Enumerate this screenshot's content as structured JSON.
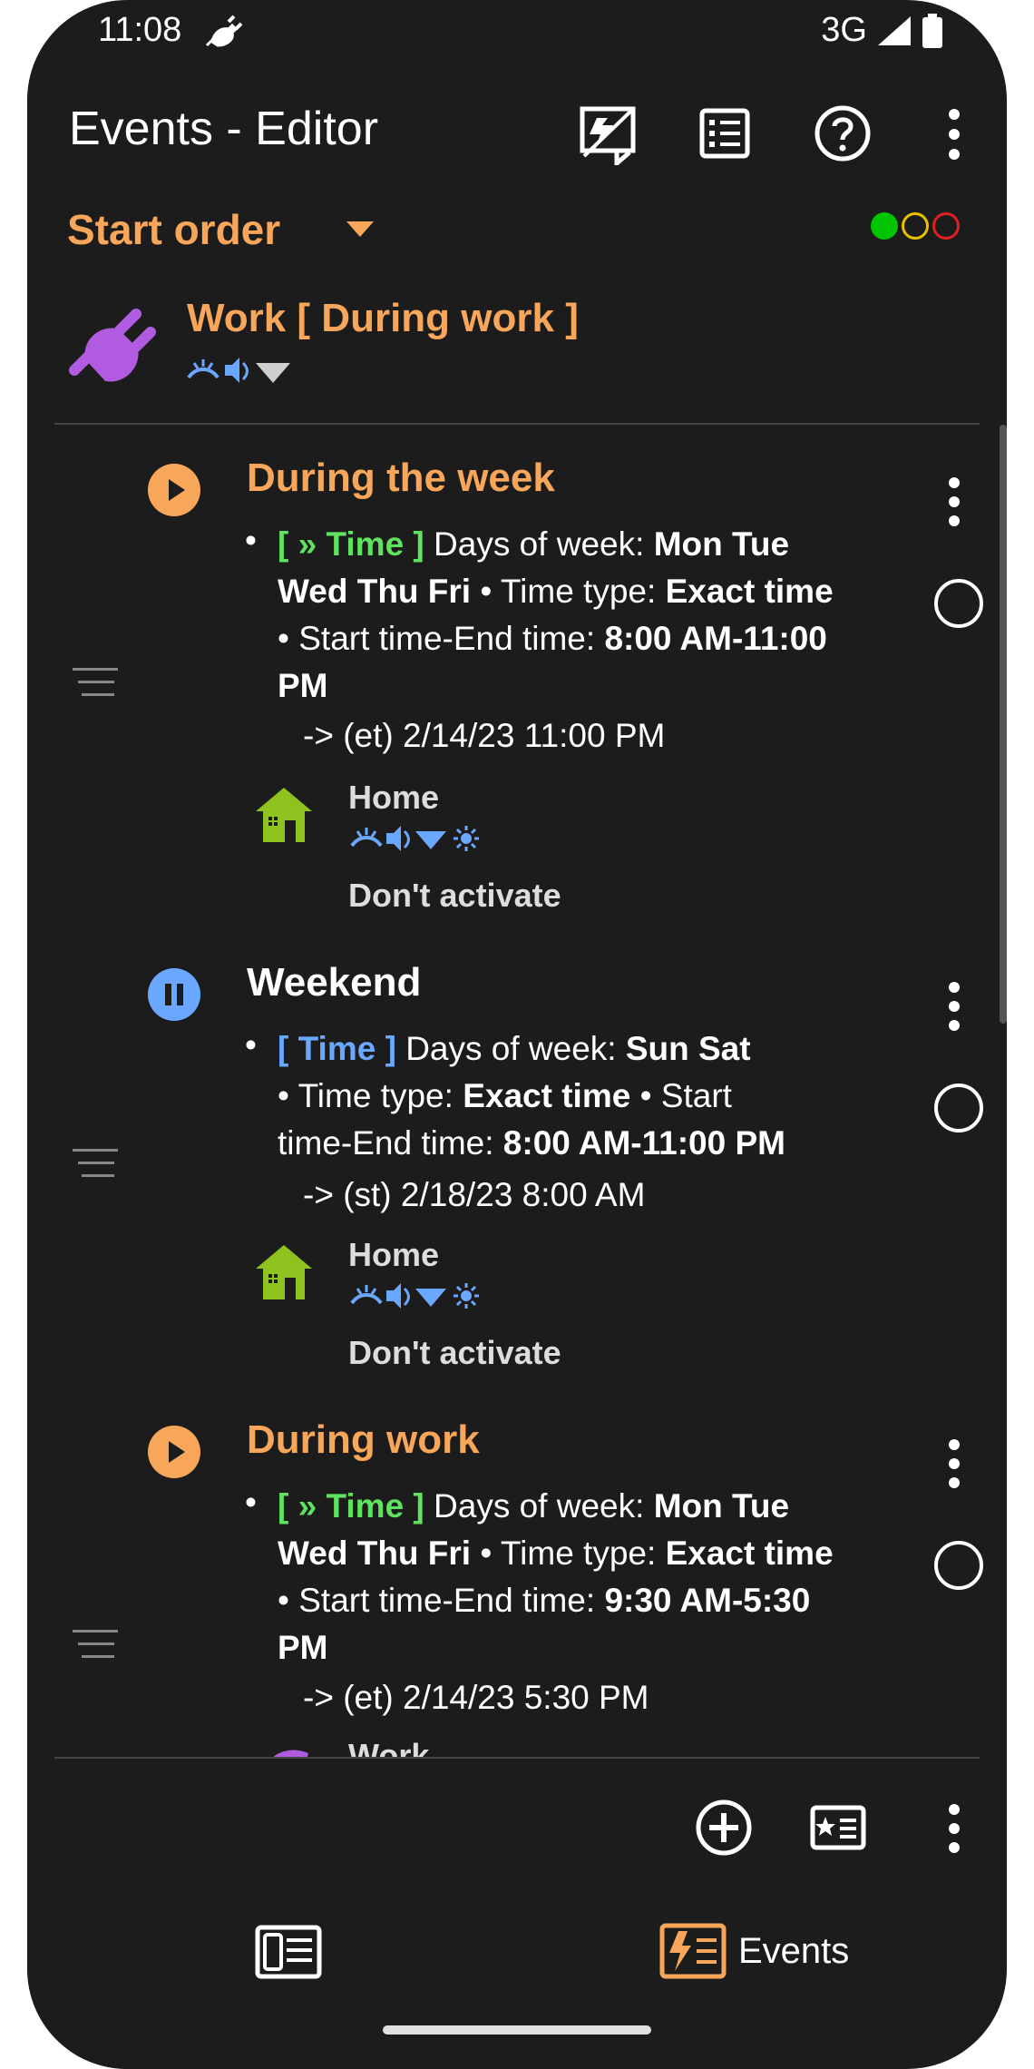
{
  "status": {
    "time": "11:08",
    "network": "3G"
  },
  "header": {
    "title": "Events - Editor"
  },
  "order": {
    "label": "Start order",
    "indicator_colors": [
      "#00c400",
      "#e8c000",
      "#e02020"
    ]
  },
  "active_profile": {
    "name": "Work [ During work ]"
  },
  "events": [
    {
      "name": "During the week",
      "state": "running",
      "condition_tag": "[ » Time ]",
      "condition_intro": "Days of week:",
      "lines": [
        {
          "text": "Mon Tue"
        },
        {
          "text": "Wed Thu Fri"
        },
        {
          "text": "• Time type:"
        },
        {
          "text": "Exact time"
        },
        {
          "text": "• Start time-End time:"
        },
        {
          "text": "8:00 AM-11:00"
        },
        {
          "text": "PM"
        }
      ],
      "next": "-> (et) 2/14/23 11:00 PM",
      "end_profile": "Home",
      "end_action": "Don't activate"
    },
    {
      "name": "Weekend",
      "state": "paused",
      "condition_tag": "[ Time ]",
      "condition_intro": "Days of week:",
      "lines": [
        {
          "text": "Sun Sat"
        },
        {
          "text": "• Time type:"
        },
        {
          "text": "Exact time"
        },
        {
          "text": "• Start"
        },
        {
          "text": "time-End time:"
        },
        {
          "text": "8:00 AM-11:00 PM"
        }
      ],
      "next": "-> (st) 2/18/23 8:00 AM",
      "end_profile": "Home",
      "end_action": "Don't activate"
    },
    {
      "name": "During work",
      "state": "running",
      "condition_tag": "[ » Time ]",
      "condition_intro": "Days of week:",
      "lines": [
        {
          "text": "Mon Tue"
        },
        {
          "text": "Wed Thu Fri"
        },
        {
          "text": "• Time type:"
        },
        {
          "text": "Exact time"
        },
        {
          "text": "• Start time-End time:"
        },
        {
          "text": "9:30 AM-5:30"
        },
        {
          "text": "PM"
        }
      ],
      "next": "-> (et) 2/14/23 5:30 PM",
      "end_profile": "Work"
    }
  ],
  "bottom_nav": {
    "events_label": "Events"
  },
  "colors": {
    "accent": "#f7a65a",
    "background": "#1c1c1c",
    "time_green": "#5fe25f",
    "time_blue": "#6aa8ff",
    "profile_icon": "#b05be0",
    "home_icon": "#8dc21f"
  }
}
